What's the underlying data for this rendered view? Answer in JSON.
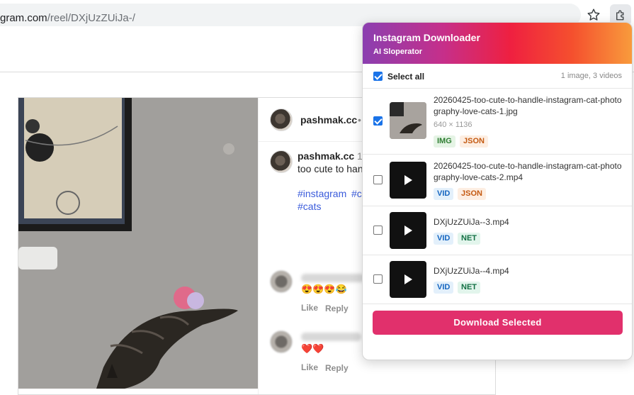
{
  "browser": {
    "url_host": "gram.com",
    "url_path": "/reel/DXjUzZUiJa-/"
  },
  "post": {
    "username": "pashmak.cc",
    "dot": "•",
    "comment_username": "pashmak.cc",
    "comment_time": "1",
    "caption": "too cute to han",
    "hashtag1": "#instagram",
    "hashtag2": "#c",
    "hashtag3": "#cats",
    "comment1_emoji": "😍😍😍😂",
    "comment2_emoji": "❤️❤️",
    "like_label": "Like",
    "reply_label": "Reply"
  },
  "popup": {
    "title": "Instagram Downloader",
    "subtitle": "AI Sloperator",
    "select_all_label": "Select all",
    "count_label": "1 image, 3 videos",
    "download_label": "Download Selected",
    "items": [
      {
        "checked": true,
        "kind": "image",
        "filename": "20260425-too-cute-to-handle-instagram-cat-photography-love-cats-1.jpg",
        "dims": "640 × 1136",
        "tags": [
          "IMG",
          "JSON"
        ]
      },
      {
        "checked": false,
        "kind": "video",
        "filename": "20260425-too-cute-to-handle-instagram-cat-photography-love-cats-2.mp4",
        "dims": "",
        "tags": [
          "VID",
          "JSON"
        ]
      },
      {
        "checked": false,
        "kind": "video",
        "filename": "DXjUzZUiJa--3.mp4",
        "dims": "",
        "tags": [
          "VID",
          "NET"
        ]
      },
      {
        "checked": false,
        "kind": "video",
        "filename": "DXjUzZUiJa--4.mp4",
        "dims": "",
        "tags": [
          "VID",
          "NET"
        ]
      }
    ]
  },
  "colors": {
    "download_button": "#e1306c",
    "checkbox_accent": "#1a73e8",
    "hashtag": "#3a5bdb"
  }
}
